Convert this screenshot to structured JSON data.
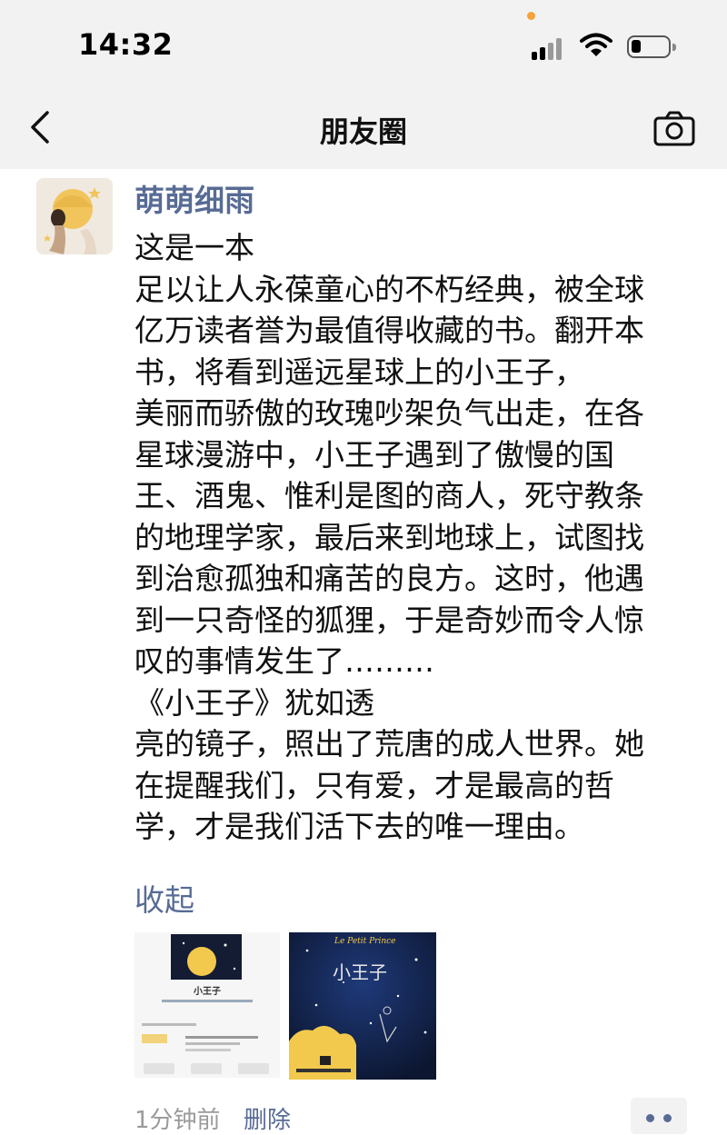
{
  "status_bar": {
    "time": "14:32"
  },
  "nav": {
    "title": "朋友圈",
    "back_icon": "chevron-left-icon",
    "camera_icon": "camera-icon"
  },
  "post": {
    "username": "萌萌细雨",
    "text_lines": [
      "这是一本",
      "足以让人永葆童心的不朽经典，被全球",
      "亿万读者誉为最值得收藏的书。翻开本",
      "书，将看到遥远星球上的小王子，",
      "美丽而骄傲的玫瑰吵架负气出走，在各",
      "星球漫游中，小王子遇到了傲慢的国",
      "王、酒鬼、惟利是图的商人，死守教条",
      "的地理学家，最后来到地球上，试图找",
      "到治愈孤独和痛苦的良方。这时，他遇",
      "到一只奇怪的狐狸，于是奇妙而令人惊",
      "叹的事情发生了………",
      "《小王子》犹如透",
      "亮的镜子，照出了荒唐的成人世界。她",
      "在提醒我们，只有爱，才是最高的哲",
      "学，才是我们活下去的唯一理由。"
    ],
    "collapse_label": "收起",
    "images": [
      {
        "title": "小王子"
      },
      {
        "title": "小王子"
      }
    ],
    "time_ago": "1分钟前",
    "delete_label": "删除"
  },
  "colors": {
    "link": "#576b95",
    "header_bg": "#f2f2f2",
    "status_dot": "#f5a33a"
  }
}
